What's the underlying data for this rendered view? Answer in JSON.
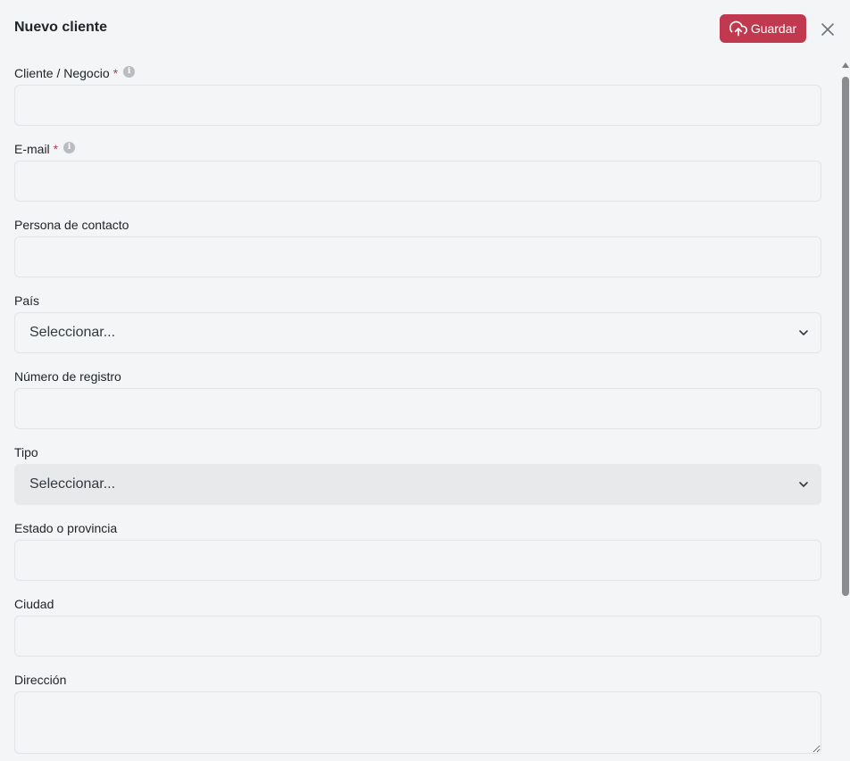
{
  "header": {
    "title": "Nuevo cliente",
    "save_label": "Guardar",
    "accent_color": "#c0394f"
  },
  "form": {
    "client": {
      "label": "Cliente / Negocio",
      "required_mark": "*",
      "value": ""
    },
    "email": {
      "label": "E-mail",
      "required_mark": "*",
      "value": ""
    },
    "contact": {
      "label": "Persona de contacto",
      "value": ""
    },
    "country": {
      "label": "País",
      "selected": "Seleccionar..."
    },
    "registration": {
      "label": "Número de registro",
      "value": ""
    },
    "type": {
      "label": "Tipo",
      "selected": "Seleccionar..."
    },
    "state": {
      "label": "Estado o provincia",
      "value": ""
    },
    "city": {
      "label": "Ciudad",
      "value": ""
    },
    "address": {
      "label": "Dirección",
      "value": ""
    }
  },
  "icons": {
    "save": "cloud-upload-icon",
    "close": "close-icon",
    "info": "info-icon",
    "dropdown": "chevron-down-icon"
  }
}
